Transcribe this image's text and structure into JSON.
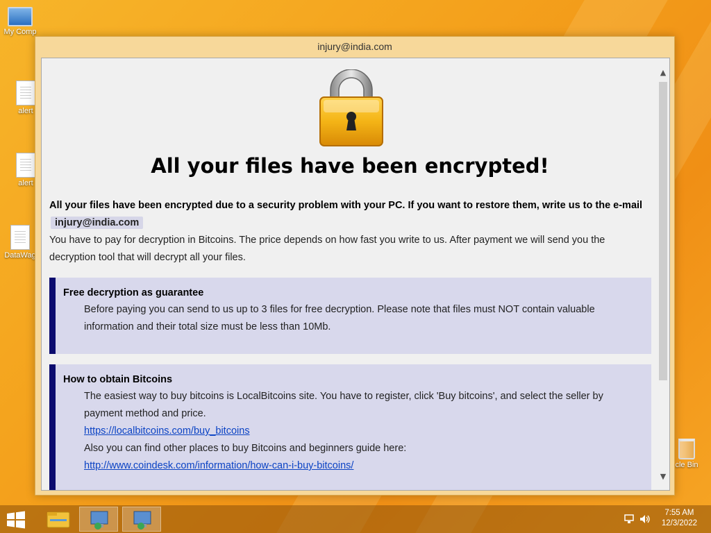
{
  "desktop": {
    "icons": [
      {
        "label": "My Comp"
      },
      {
        "label": "alert"
      },
      {
        "label": "alert"
      },
      {
        "label": "DataWag"
      },
      {
        "label": "cle Bin"
      }
    ]
  },
  "window": {
    "title": "injury@india.com"
  },
  "note": {
    "heading": "All your files have been encrypted!",
    "intro_bold": "All your files have been encrypted due to a security problem with your PC. If you want to restore them, write us to the e-mail",
    "email": "injury@india.com",
    "intro_text": "You have to pay for decryption in Bitcoins. The price depends on how fast you write to us. After payment we will send you the decryption tool that will decrypt all your files.",
    "sections": [
      {
        "title": "Free decryption as guarantee",
        "text": "Before paying you can send to us up to 3 files for free decryption. Please note that files must NOT contain valuable information and their total size must be less than 10Mb."
      },
      {
        "title": "How to obtain Bitcoins",
        "text": "The easiest way to buy bitcoins is LocalBitcoins site. You have to register, click 'Buy bitcoins', and select the seller by payment method and price.",
        "link1": "https://localbitcoins.com/buy_bitcoins",
        "text2": "Also you can find other places to buy Bitcoins and beginners guide here:",
        "link2": "http://www.coindesk.com/information/how-can-i-buy-bitcoins/"
      }
    ]
  },
  "taskbar": {
    "time": "7:55 AM",
    "date": "12/3/2022"
  },
  "icons": {
    "lock": "padlock-icon",
    "start": "windows-start-icon",
    "explorer": "file-explorer-icon",
    "network": "network-icon",
    "volume": "volume-icon"
  }
}
